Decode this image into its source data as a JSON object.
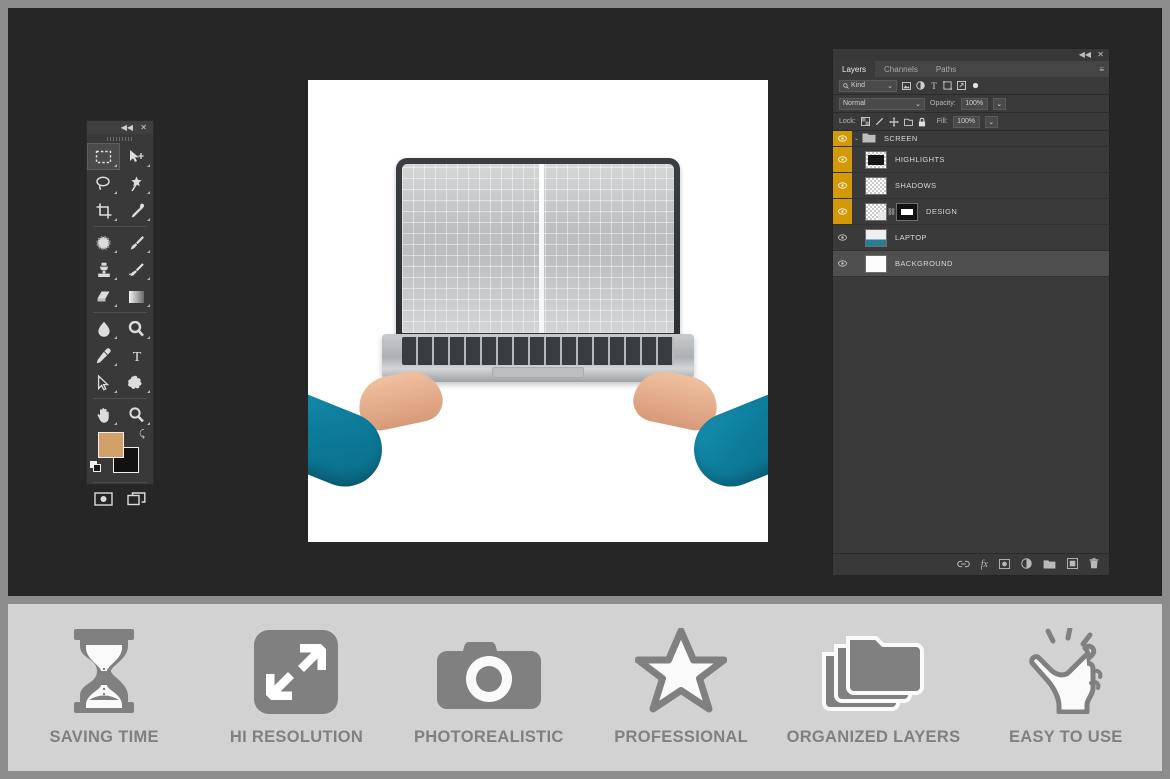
{
  "workspace": {
    "background_color": "#262626",
    "outer_frame_color": "#8c8c8c"
  },
  "tools_panel": {
    "collapse_label": "◀◀",
    "close_label": "✕",
    "tools": [
      {
        "name": "rectangular-marquee-tool",
        "selected": true
      },
      {
        "name": "move-tool",
        "selected": false
      },
      {
        "name": "lasso-tool",
        "selected": false
      },
      {
        "name": "magic-wand-tool",
        "selected": false
      },
      {
        "name": "crop-tool",
        "selected": false
      },
      {
        "name": "eyedropper-tool",
        "selected": false
      },
      {
        "name": "spot-healing-brush-tool",
        "selected": false
      },
      {
        "name": "brush-tool",
        "selected": false
      },
      {
        "name": "clone-stamp-tool",
        "selected": false
      },
      {
        "name": "history-brush-tool",
        "selected": false
      },
      {
        "name": "eraser-tool",
        "selected": false
      },
      {
        "name": "gradient-tool",
        "selected": false
      },
      {
        "name": "blur-tool",
        "selected": false
      },
      {
        "name": "dodge-tool",
        "selected": false
      },
      {
        "name": "pen-tool",
        "selected": false
      },
      {
        "name": "type-tool",
        "selected": false
      },
      {
        "name": "path-selection-tool",
        "selected": false
      },
      {
        "name": "custom-shape-tool",
        "selected": false
      },
      {
        "name": "hand-tool",
        "selected": false
      },
      {
        "name": "zoom-tool",
        "selected": false
      }
    ],
    "foreground_color": "#d2a16a",
    "background_color": "#111111",
    "type_label": "T"
  },
  "layers_panel": {
    "titlebar": {
      "collapse_label": "◀◀",
      "close_label": "✕"
    },
    "tabs": [
      {
        "label": "Layers",
        "active": true
      },
      {
        "label": "Channels",
        "active": false
      },
      {
        "label": "Paths",
        "active": false
      }
    ],
    "menu_label": "≡",
    "filter": {
      "kind_label": "Kind",
      "search_icon": "search-icon",
      "chevron": "⌄",
      "icons": [
        "pixel-layer-filter-icon",
        "adjustment-layer-filter-icon",
        "type-layer-filter-icon",
        "shape-layer-filter-icon",
        "smart-object-filter-icon"
      ],
      "toggle": "filter-toggle-icon"
    },
    "blend": {
      "mode": "Normal",
      "chevron": "⌄",
      "opacity_label": "Opacity:",
      "opacity_value": "100%"
    },
    "lock": {
      "label": "Lock:",
      "icons": [
        "lock-transparent-pixels-icon",
        "lock-image-pixels-icon",
        "lock-position-icon",
        "lock-artboard-nesting-icon",
        "lock-all-icon"
      ],
      "fill_label": "Fill:",
      "fill_value": "100%"
    },
    "layers": [
      {
        "name": "SCREEN",
        "type": "group",
        "visible": true,
        "visibility_highlight": true,
        "selected": false,
        "twisty": "⌄"
      },
      {
        "name": "HIGHLIGHTS",
        "type": "pixel",
        "visible": true,
        "visibility_highlight": true,
        "selected": false
      },
      {
        "name": "SHADOWS",
        "type": "pixel",
        "visible": true,
        "visibility_highlight": true,
        "selected": false
      },
      {
        "name": "DESIGN",
        "type": "smart-object",
        "visible": true,
        "visibility_highlight": true,
        "selected": false,
        "has_mask": true
      },
      {
        "name": "LAPTOP",
        "type": "pixel",
        "visible": true,
        "visibility_highlight": false,
        "selected": false
      },
      {
        "name": "BACKGROUND",
        "type": "pixel",
        "visible": true,
        "visibility_highlight": false,
        "selected": true
      }
    ],
    "bottom_icons": [
      "link-layers-icon",
      "add-layer-style-icon",
      "add-layer-mask-icon",
      "new-adjustment-layer-icon",
      "new-group-icon",
      "new-layer-icon",
      "delete-layer-icon"
    ],
    "fx_label": "fx"
  },
  "canvas": {
    "background_color": "#ffffff",
    "artwork": "hands-holding-laptop-mockup",
    "screen_content": "transparency-grid-placeholder"
  },
  "features": [
    {
      "icon": "hourglass-icon",
      "label": "SAVING TIME"
    },
    {
      "icon": "resize-arrows-icon",
      "label": "HI RESOLUTION"
    },
    {
      "icon": "camera-icon",
      "label": "PHOTOREALISTIC"
    },
    {
      "icon": "star-icon",
      "label": "PROFESSIONAL"
    },
    {
      "icon": "folders-icon",
      "label": "ORGANIZED LAYERS"
    },
    {
      "icon": "tap-hand-icon",
      "label": "EASY TO USE"
    }
  ],
  "colors": {
    "feature_band": "#d2d2d2",
    "feature_gray": "#808080",
    "layer_highlight": "#d39a08"
  }
}
